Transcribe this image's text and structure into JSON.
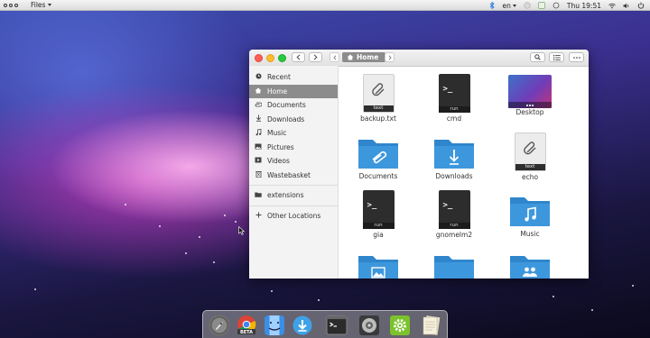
{
  "topbar": {
    "app_menu": "Files",
    "keyboard_layout": "en",
    "clock": "Thu 19:51"
  },
  "window": {
    "path": {
      "current": "Home"
    },
    "sidebar": [
      {
        "label": "Recent",
        "icon": "clock-icon"
      },
      {
        "label": "Home",
        "icon": "home-icon",
        "active": true
      },
      {
        "label": "Documents",
        "icon": "paperclip-icon"
      },
      {
        "label": "Downloads",
        "icon": "download-icon"
      },
      {
        "label": "Music",
        "icon": "music-note-icon"
      },
      {
        "label": "Pictures",
        "icon": "image-icon"
      },
      {
        "label": "Videos",
        "icon": "video-icon"
      },
      {
        "label": "Wastebasket",
        "icon": "trash-icon"
      },
      {
        "label": "extensions",
        "icon": "folder-icon"
      },
      {
        "label": "Other Locations",
        "icon": "plus-icon"
      }
    ],
    "files": [
      {
        "name": "backup.txt",
        "kind": "text",
        "tag": "text"
      },
      {
        "name": "cmd",
        "kind": "executable",
        "tag": "run"
      },
      {
        "name": "Desktop",
        "kind": "desktop"
      },
      {
        "name": "Documents",
        "kind": "folder-documents"
      },
      {
        "name": "Downloads",
        "kind": "folder-downloads"
      },
      {
        "name": "echo",
        "kind": "text",
        "tag": "text"
      },
      {
        "name": "gia",
        "kind": "executable",
        "tag": "run"
      },
      {
        "name": "gnomelm2",
        "kind": "executable",
        "tag": "run"
      },
      {
        "name": "Music",
        "kind": "folder-music"
      }
    ]
  },
  "dock": {
    "apps": [
      {
        "icon": "launchpad-rocket-icon"
      },
      {
        "icon": "chrome-beta-icon",
        "badge": "BETA"
      },
      {
        "icon": "finder-icon"
      },
      {
        "icon": "downloads-icon"
      },
      {
        "icon": "terminal-icon"
      },
      {
        "icon": "disk-utility-icon"
      },
      {
        "icon": "settings-icon"
      },
      {
        "icon": "notes-icon"
      }
    ]
  },
  "colors": {
    "folder_blue": "#3d97dc",
    "sidebar_selected": "#8c8c8c",
    "close": "#ff5f57",
    "minimize": "#febc2e",
    "maximize": "#28c840"
  }
}
